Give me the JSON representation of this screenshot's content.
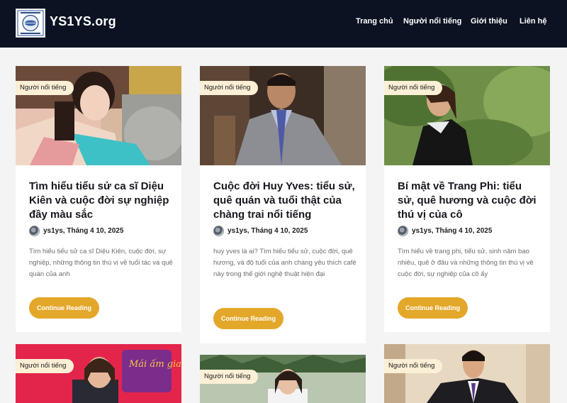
{
  "header": {
    "site_title": "YS1YS.org",
    "nav": [
      "Trang chủ",
      "Người nổi tiếng",
      "Giới thiệu",
      "Liên hệ"
    ]
  },
  "posts": [
    {
      "category": "Người nổi tiếng",
      "title": "Tìm hiểu tiểu sử ca sĩ Diệu Kiên và cuộc đời sự nghiệp đầy màu sắc",
      "meta": "ys1ys, Tháng 4 10, 2025",
      "excerpt": "Tìm hiểu tiểu sử ca sĩ Diệu Kiên, cuộc đời, sự nghiệp, những thông tin thú vị về tuổi tác và quê quán của anh",
      "button": "Continue Reading"
    },
    {
      "category": "Người nổi tiếng",
      "title": "Cuộc đời Huy Yves: tiểu sử, quê quán và tuổi thật của chàng trai nổi tiếng",
      "meta": "ys1ys, Tháng 4 10, 2025",
      "excerpt": "huy yves là ai? Tìm hiểu tiểu sử, cuộc đời, quê hương, và độ tuổi của anh chàng yêu thích café này trong thế giới nghệ thuật hiện đại",
      "button": "Continue Reading"
    },
    {
      "category": "Người nổi tiếng",
      "title": "Bí mật về Trang Phi: tiểu sử, quê hương và cuộc đời thú vị của cô",
      "meta": "ys1ys, Tháng 4 10, 2025",
      "excerpt": "Tìm hiểu về trang phi, tiểu sử, sinh năm bao nhiêu, quê ở đâu và những thông tin thú vị về cuộc đời, sự nghiệp của cô ấy",
      "button": "Continue Reading"
    },
    {
      "category": "Người nổi tiếng",
      "image_text": "Mái ấm gia đình Việt"
    },
    {
      "category": "Người nổi tiếng"
    },
    {
      "category": "Người nổi tiếng"
    }
  ]
}
